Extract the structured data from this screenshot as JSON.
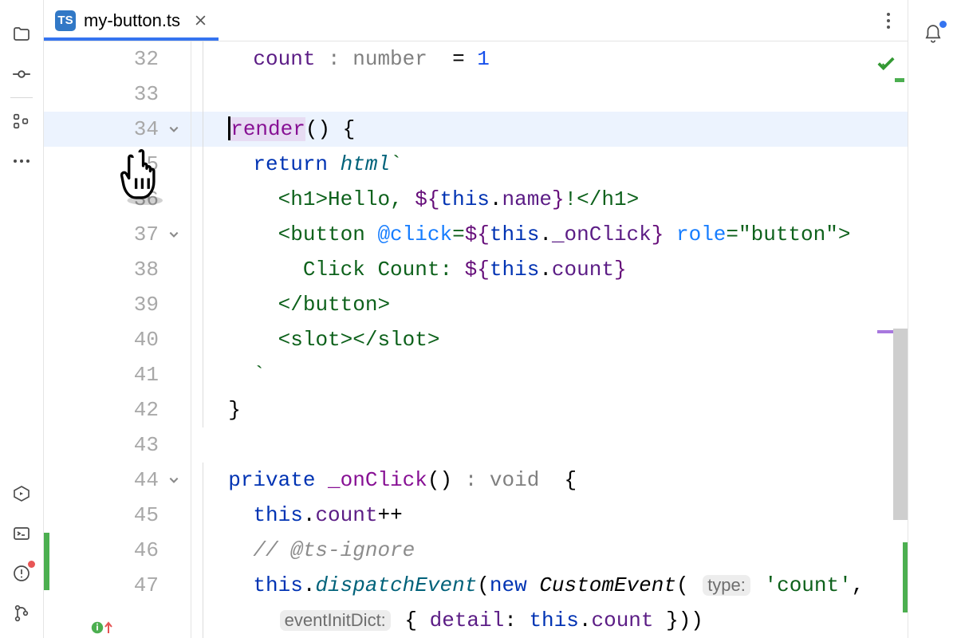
{
  "tab": {
    "filename": "my-button.ts",
    "badge": "TS"
  },
  "gutter": {
    "lines": [
      "32",
      "33",
      "34",
      "35",
      "36",
      "37",
      "38",
      "39",
      "40",
      "41",
      "42",
      "43",
      "44",
      "45",
      "46",
      "47"
    ],
    "folds": {
      "34": true,
      "37": true,
      "44": true
    },
    "mod_start": 46,
    "mod_end": 47
  },
  "code": {
    "32": {
      "indent": 1,
      "tokens": [
        [
          "id",
          "count "
        ],
        [
          "hint",
          ": number  "
        ],
        [
          "pun",
          "= "
        ],
        [
          "num",
          "1"
        ]
      ]
    },
    "33": {
      "indent": 0,
      "tokens": []
    },
    "34": {
      "indent": 0,
      "tokens": [
        [
          "cursor",
          ""
        ],
        [
          "render",
          "render"
        ],
        [
          "pun",
          "() {"
        ]
      ],
      "hl": true
    },
    "35": {
      "indent": 1,
      "tokens": [
        [
          "kw",
          "return "
        ],
        [
          "call",
          "html"
        ],
        [
          "str",
          "`"
        ]
      ]
    },
    "36": {
      "indent": 2,
      "tokens": [
        [
          "str",
          "<"
        ],
        [
          "tag",
          "h1"
        ],
        [
          "str",
          ">Hello, "
        ],
        [
          "tmpl",
          "${"
        ],
        [
          "kw",
          "this"
        ],
        [
          "pun",
          "."
        ],
        [
          "id2",
          "name"
        ],
        [
          "tmpl",
          "}"
        ],
        [
          "str",
          "!</"
        ],
        [
          "tag",
          "h1"
        ],
        [
          "str",
          ">"
        ]
      ]
    },
    "37": {
      "indent": 2,
      "tokens": [
        [
          "str",
          "<"
        ],
        [
          "tag",
          "button "
        ],
        [
          "attr",
          "@click"
        ],
        [
          "str",
          "="
        ],
        [
          "tmpl",
          "${"
        ],
        [
          "kw",
          "this"
        ],
        [
          "pun",
          "."
        ],
        [
          "id2",
          "_onClick"
        ],
        [
          "tmpl",
          "}"
        ],
        [
          "str",
          " "
        ],
        [
          "attr",
          "role"
        ],
        [
          "str",
          "="
        ],
        [
          "strv",
          "\"button\""
        ],
        [
          "str",
          ">"
        ]
      ]
    },
    "38": {
      "indent": 3,
      "tokens": [
        [
          "str",
          "Click Count: "
        ],
        [
          "tmpl",
          "${"
        ],
        [
          "kw",
          "this"
        ],
        [
          "pun",
          "."
        ],
        [
          "id2",
          "count"
        ],
        [
          "tmpl",
          "}"
        ]
      ]
    },
    "39": {
      "indent": 2,
      "tokens": [
        [
          "str",
          "</"
        ],
        [
          "tag",
          "button"
        ],
        [
          "str",
          ">"
        ]
      ]
    },
    "40": {
      "indent": 2,
      "tokens": [
        [
          "str",
          "<"
        ],
        [
          "tag",
          "slot"
        ],
        [
          "str",
          "></"
        ],
        [
          "tag",
          "slot"
        ],
        [
          "str",
          ">"
        ]
      ]
    },
    "41": {
      "indent": 1,
      "tokens": [
        [
          "str",
          "`"
        ]
      ]
    },
    "42": {
      "indent": 0,
      "tokens": [
        [
          "pun",
          "}"
        ]
      ]
    },
    "43": {
      "indent": -1,
      "tokens": []
    },
    "44": {
      "indent": 0,
      "tokens": [
        [
          "kw",
          "private "
        ],
        [
          "fn",
          "_onClick"
        ],
        [
          "pun",
          "() "
        ],
        [
          "hint",
          ": void  "
        ],
        [
          "pun",
          "{"
        ]
      ]
    },
    "45": {
      "indent": 1,
      "tokens": [
        [
          "kw",
          "this"
        ],
        [
          "pun",
          "."
        ],
        [
          "id2",
          "count"
        ],
        [
          "pun",
          "++"
        ]
      ]
    },
    "46": {
      "indent": 1,
      "tokens": [
        [
          "comment",
          "// @ts-ignore"
        ]
      ]
    },
    "47": {
      "indent": 1,
      "tokens": [
        [
          "kw",
          "this"
        ],
        [
          "pun",
          "."
        ],
        [
          "call",
          "dispatchEvent"
        ],
        [
          "pun",
          "("
        ],
        [
          "kw",
          "new "
        ],
        [
          "cls",
          "CustomEvent"
        ],
        [
          "pun",
          "( "
        ],
        [
          "inlay",
          "type:"
        ],
        [
          "pun",
          " "
        ],
        [
          "strv",
          "'count'"
        ],
        [
          "pun",
          ","
        ]
      ]
    },
    "48": {
      "indent": 2,
      "tokens": [
        [
          "inlay",
          "eventInitDict:"
        ],
        [
          "pun",
          " { "
        ],
        [
          "id2",
          "detail"
        ],
        [
          "pun",
          ": "
        ],
        [
          "kw",
          "this"
        ],
        [
          "pun",
          "."
        ],
        [
          "id2",
          "count"
        ],
        [
          "pun",
          " }))"
        ]
      ]
    }
  },
  "marks": {
    "green": [
      48,
      488,
      548
    ],
    "purple_thick": 362
  }
}
